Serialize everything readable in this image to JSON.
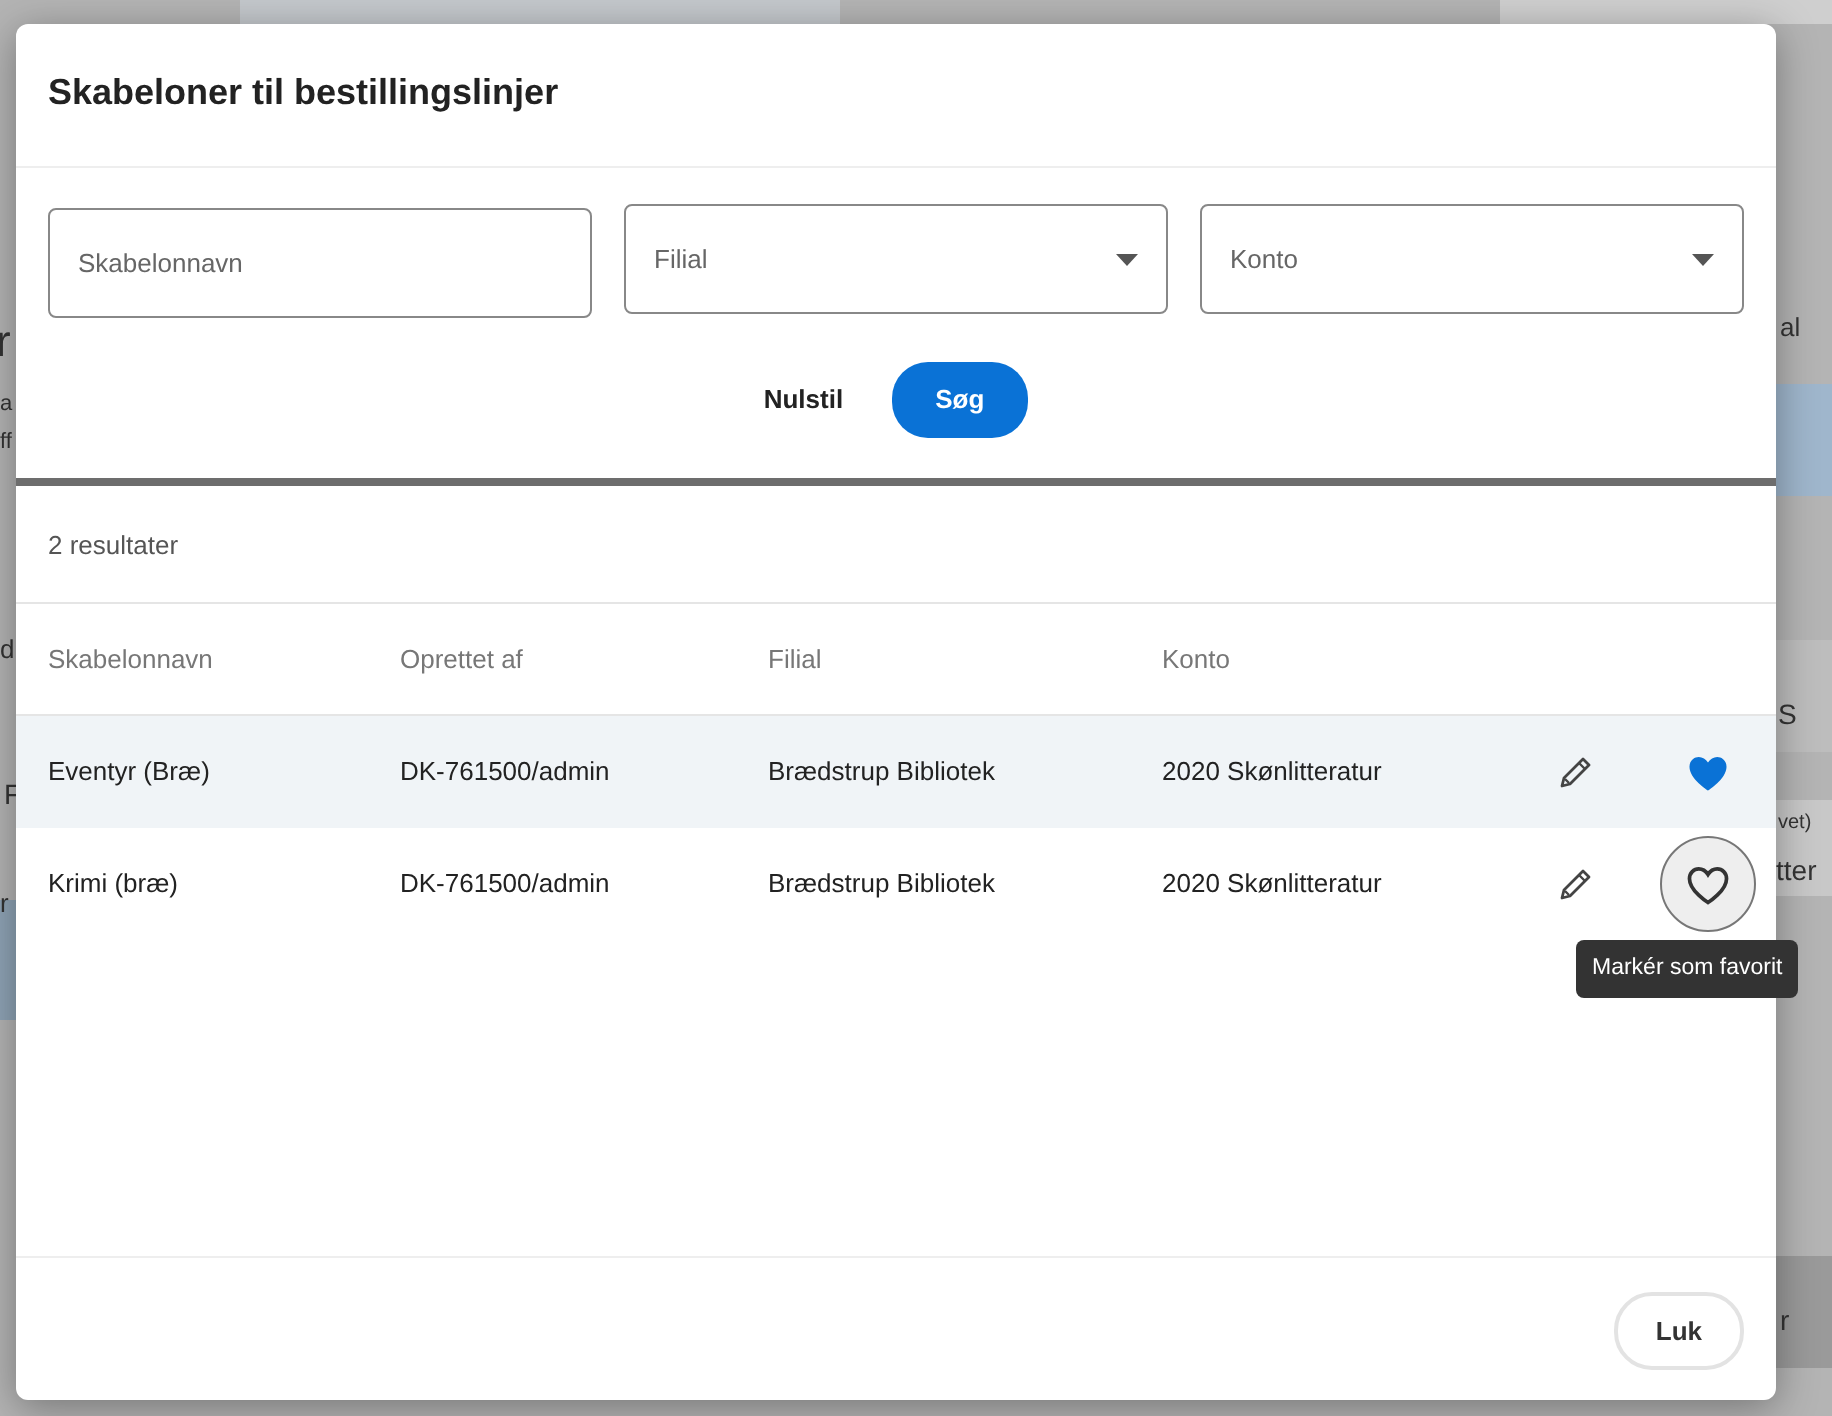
{
  "background": {
    "left": [
      "r",
      "a",
      "ff",
      "d",
      "F",
      "r"
    ],
    "right": [
      "al",
      "S",
      "vet)",
      "tter",
      "r"
    ]
  },
  "dialog": {
    "title": "Skabeloner til bestillingslinjer",
    "filters": [
      {
        "kind": "text",
        "placeholder": "Skabelonnavn"
      },
      {
        "kind": "select",
        "placeholder": "Filial"
      },
      {
        "kind": "select",
        "placeholder": "Konto"
      }
    ],
    "reset_button": "Nulstil",
    "search_button": "Søg",
    "result_count": "2 resultater",
    "table": {
      "columns": [
        "Skabelonnavn",
        "Oprettet af",
        "Filial",
        "Konto"
      ],
      "rows": [
        {
          "cells": [
            "Eventyr (Bræ)",
            "DK-761500/admin",
            "Brædstrup Bibliotek",
            "2020 Skønlitteratur"
          ],
          "favorite": true,
          "hovered": true
        },
        {
          "cells": [
            "Krimi (bræ)",
            "DK-761500/admin",
            "Brædstrup Bibliotek",
            "2020 Skønlitteratur"
          ],
          "favorite": false,
          "hovered": false
        }
      ]
    },
    "tooltip": "Markér som favorit",
    "close_button": "Luk"
  }
}
